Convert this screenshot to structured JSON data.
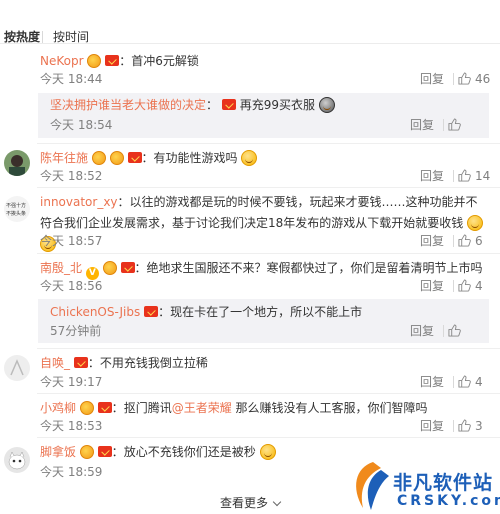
{
  "sort": {
    "hot": "按热度",
    "time": "按时间"
  },
  "actions": {
    "reply": "回复"
  },
  "comments": [
    {
      "user": "NeKopr",
      "text": "首冲6元解锁",
      "time": "今天 18:44",
      "likes": "46",
      "sub": {
        "user": "坚决拥护谁当老大谁做的决定",
        "text": "再充99买衣服",
        "time": "今天 18:54"
      }
    },
    {
      "user": "陈年往施",
      "text": "有功能性游戏吗",
      "time": "今天 18:52",
      "likes": "14"
    },
    {
      "user": "innovator_xy",
      "text": "以往的游戏都是玩的时候不要钱，玩起来才要钱……这种功能并不符合我们企业发展需求，基于讨论我们决定18年发布的游戏从下载开始就要收钱",
      "time": "今天 18:57",
      "likes": "6"
    },
    {
      "user": "南殷_北",
      "text": "绝地求生国服还不来？寒假都快过了，你们是留着清明节上市吗",
      "time": "今天 18:56",
      "likes": "4",
      "sub": {
        "user": "ChickenOS-Jibs",
        "text": "现在卡在了一个地方，所以不能上市",
        "time": "57分钟前"
      }
    },
    {
      "user": "自唤_",
      "text": "不用充钱我倒立拉稀",
      "time": "今天 19:17",
      "likes": "4"
    },
    {
      "user": "小鸡柳",
      "text": "抠门腾讯",
      "mention": "@王者荣耀",
      "text2": " 那么赚钱没有人工客服，你们智障吗",
      "time": "今天 18:53",
      "likes": "3"
    },
    {
      "user": "脚拿饭",
      "text": "放心不充钱你们还是被秒",
      "time": "今天 18:59",
      "likes": ""
    }
  ],
  "more": "查看更多",
  "watermark": {
    "title": "非凡软件站",
    "sub": "CRSKY.com"
  },
  "colors": {
    "username": "#eb7350",
    "meta": "#808080",
    "subbox": "#f2f2f5",
    "watermark": "#1d5fb8"
  }
}
